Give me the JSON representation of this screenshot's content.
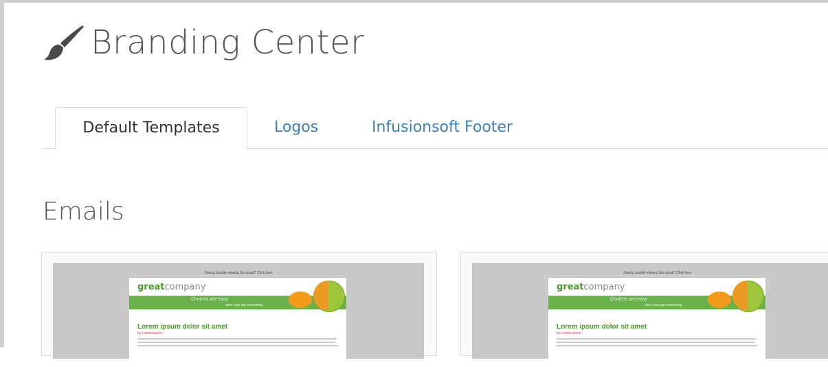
{
  "header": {
    "title": "Branding Center",
    "icon": "brush-icon"
  },
  "tabs": [
    {
      "label": "Default Templates",
      "active": true
    },
    {
      "label": "Logos",
      "active": false
    },
    {
      "label": "Infusionsoft Footer",
      "active": false
    }
  ],
  "sections": {
    "emails_title": "Emails"
  },
  "email_preview": {
    "top_note": "Having trouble viewing this email? Click here",
    "logo_prefix": "great",
    "logo_suffix": "company",
    "banner_text": "Choices are easy",
    "banner_sub": "when you get something",
    "headline": "Lorem ipsum dolor sit amet",
    "subline": "by Lorem ipsum"
  },
  "colors": {
    "tab_link": "#3d7fb5",
    "title": "#555555",
    "accent_green": "#6ab04c"
  }
}
